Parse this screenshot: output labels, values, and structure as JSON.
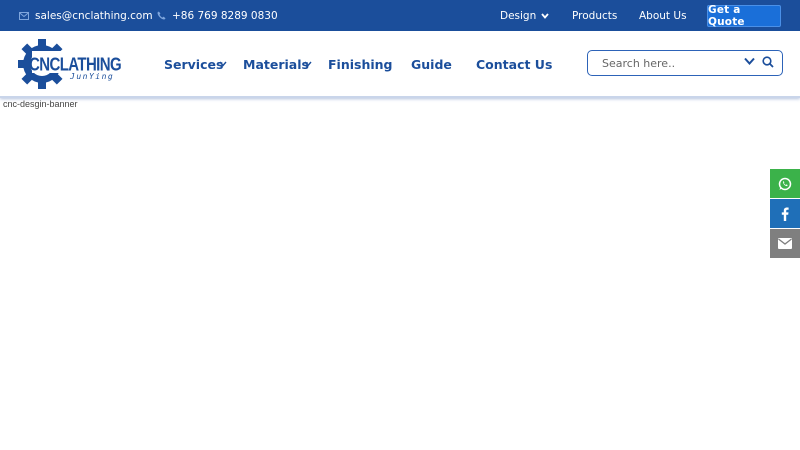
{
  "topbar": {
    "email": "sales@cnclathing.com",
    "phone": "+86 769 8289 0830",
    "links": [
      "Design",
      "Products",
      "About Us"
    ],
    "quote_button": "Get a Quote",
    "icons": [
      "mail-icon",
      "phone-icon",
      "chevron-down-icon"
    ]
  },
  "logo": {
    "title": "CNCLATHING",
    "subtitle": "JunYing"
  },
  "nav": {
    "items": [
      "Services",
      "Materials",
      "Finishing",
      "Guide",
      "Contact Us"
    ]
  },
  "search": {
    "placeholder": "Search here.."
  },
  "banner": {
    "alt_text": "cnc-desgin-banner"
  },
  "social": {
    "items": [
      "whatsapp-icon",
      "facebook-icon",
      "email-icon"
    ],
    "colors": [
      "#3bb24a",
      "#1f6fb8",
      "#7f7f7f"
    ]
  },
  "colors": {
    "brand_blue": "#1b4e9b",
    "accent_blue": "#1a6fd9"
  }
}
